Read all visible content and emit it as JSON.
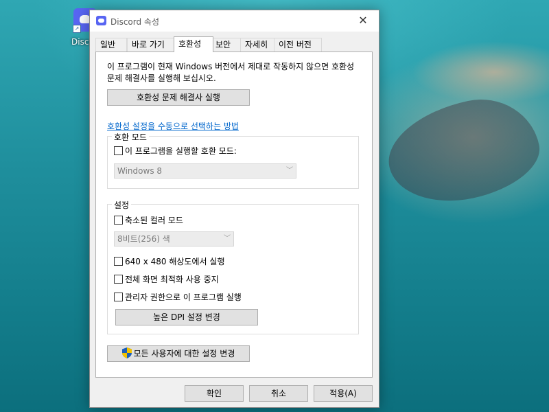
{
  "desktop": {
    "icon_label": "Disco"
  },
  "window": {
    "title": "Discord 속성",
    "close_glyph": "✕"
  },
  "tabs": [
    {
      "label": "일반"
    },
    {
      "label": "바로 가기"
    },
    {
      "label": "호환성"
    },
    {
      "label": "보안"
    },
    {
      "label": "자세히"
    },
    {
      "label": "이전 버전"
    }
  ],
  "compat": {
    "intro": "이 프로그램이 현재 Windows 버전에서 제대로 작동하지 않으면 호환성 문제 해결사를 실행해 보십시오.",
    "troubleshooter_button": "호환성 문제 해결사 실행",
    "manual_link": "호환성 설정을 수동으로 선택하는 방법",
    "mode_group": {
      "legend": "호환 모드",
      "checkbox_label": "이 프로그램을 실행할 호환 모드:",
      "checked": false,
      "select_value": "Windows 8"
    },
    "settings_group": {
      "legend": "설정",
      "reduced_color_label": "축소된 컬러 모드",
      "color_select_value": "8비트(256) 색",
      "res640_label": "640 x 480 해상도에서 실행",
      "fullscreen_opt_label": "전체 화면 최적화 사용 중지",
      "admin_label": "관리자 권한으로 이 프로그램 실행",
      "dpi_button": "높은 DPI 설정 변경"
    },
    "all_users_button": "모든 사용자에 대한 설정 변경"
  },
  "footer": {
    "ok": "확인",
    "cancel": "취소",
    "apply": "적용(A)"
  }
}
